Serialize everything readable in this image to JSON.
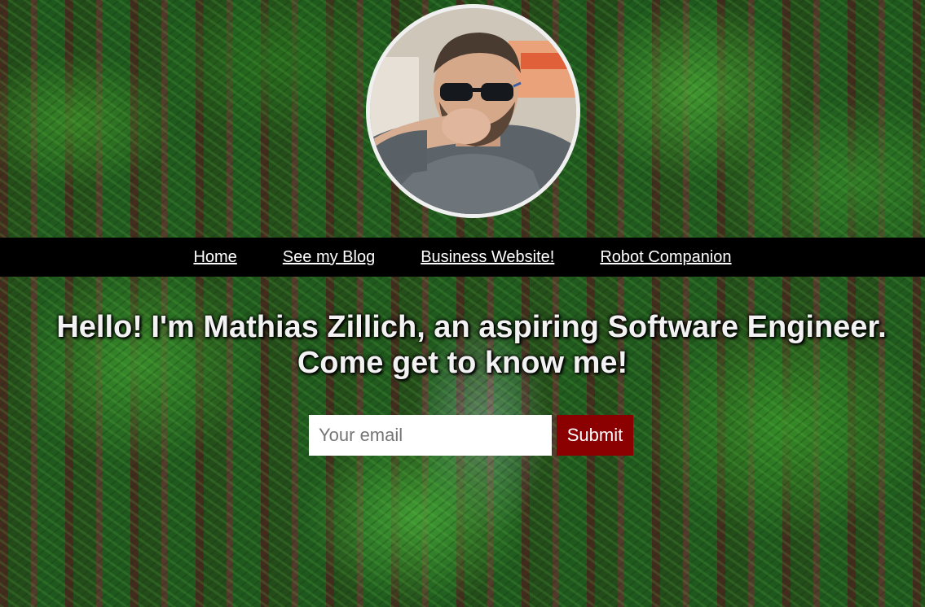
{
  "profile": {
    "avatar_description": "profile-photo"
  },
  "nav": {
    "items": [
      {
        "label": "Home"
      },
      {
        "label": "See my Blog"
      },
      {
        "label": "Business Website!"
      },
      {
        "label": "Robot Companion"
      }
    ]
  },
  "hero": {
    "headline_line1": "Hello! I'm Mathias Zillich, an aspiring Software Engineer.",
    "headline_line2": "Come get to know me!"
  },
  "signup": {
    "email_placeholder": "Your email",
    "email_value": "",
    "submit_label": "Submit"
  },
  "colors": {
    "nav_background": "#000000",
    "submit_background": "#8b0000",
    "avatar_border": "#f0f0f0"
  }
}
